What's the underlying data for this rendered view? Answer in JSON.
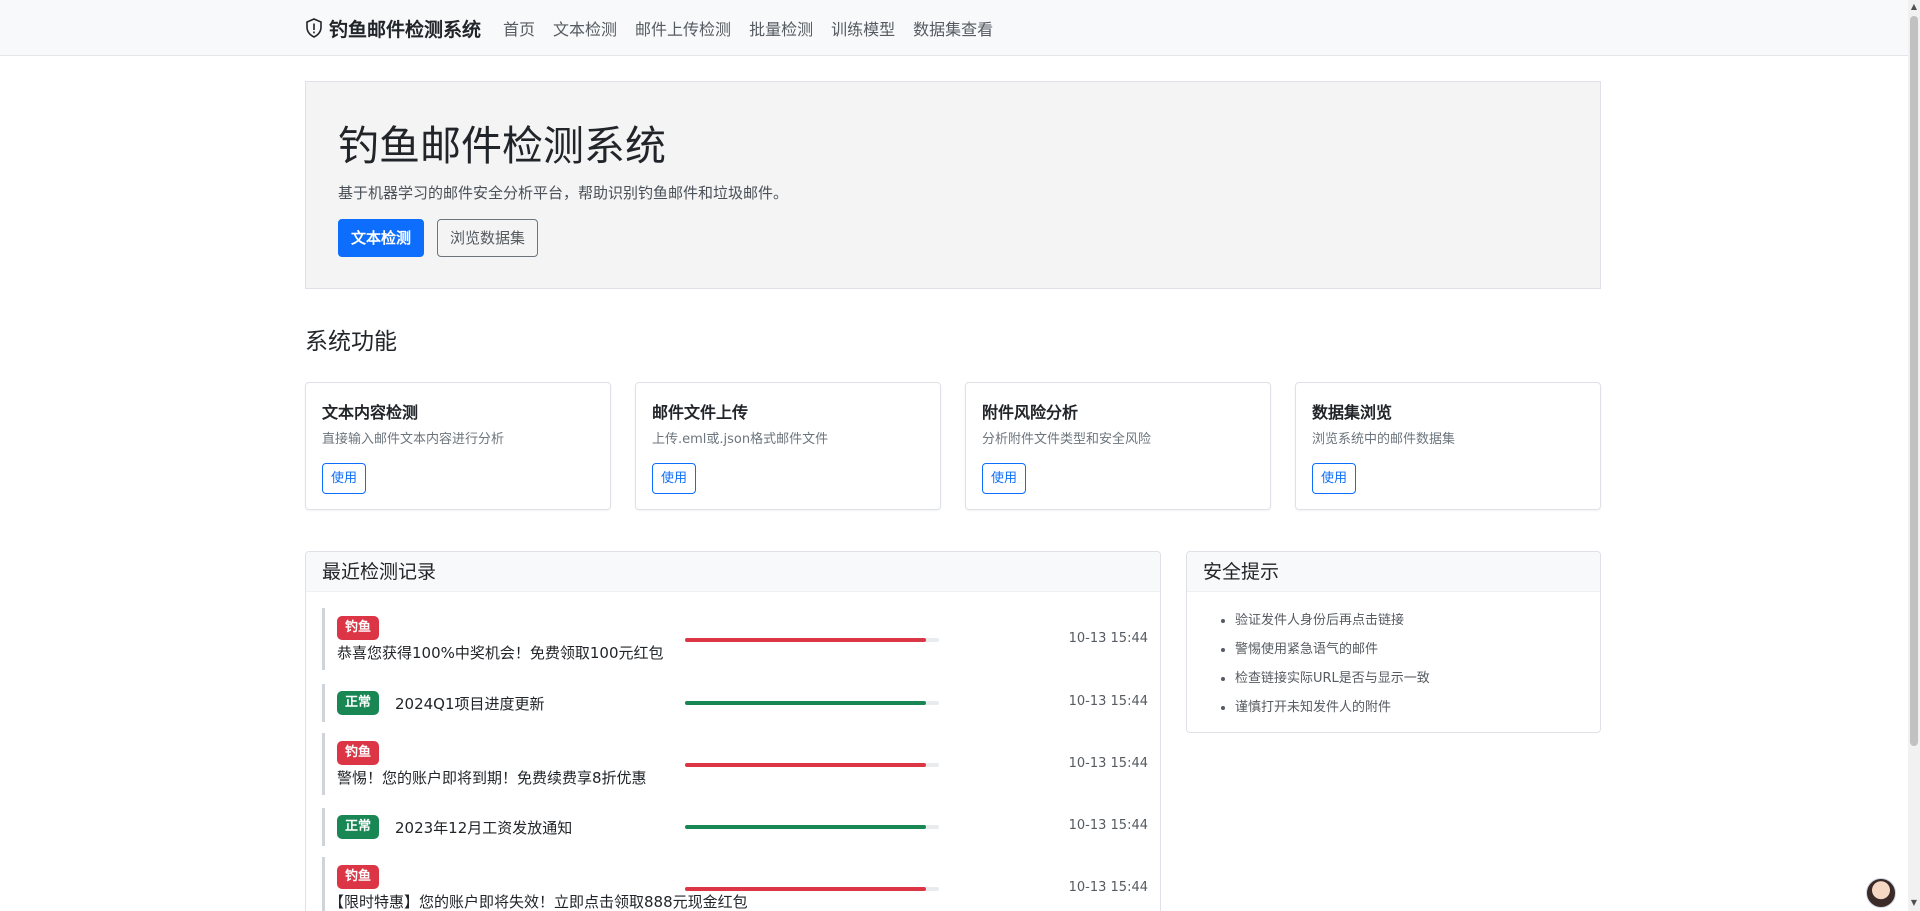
{
  "navbar": {
    "brand": "钓鱼邮件检测系统",
    "links": [
      "首页",
      "文本检测",
      "邮件上传检测",
      "批量检测",
      "训练模型",
      "数据集查看"
    ]
  },
  "hero": {
    "title": "钓鱼邮件检测系统",
    "subtitle": "基于机器学习的邮件安全分析平台，帮助识别钓鱼邮件和垃圾邮件。",
    "primary_button": "文本检测",
    "secondary_button": "浏览数据集"
  },
  "features": {
    "title": "系统功能",
    "cards": [
      {
        "title": "文本内容检测",
        "desc": "直接输入邮件文本内容进行分析",
        "button": "使用"
      },
      {
        "title": "邮件文件上传",
        "desc": "上传.eml或.json格式邮件文件",
        "button": "使用"
      },
      {
        "title": "附件风险分析",
        "desc": "分析附件文件类型和安全风险",
        "button": "使用"
      },
      {
        "title": "数据集浏览",
        "desc": "浏览系统中的邮件数据集",
        "button": "使用"
      }
    ]
  },
  "records": {
    "title": "最近检测记录",
    "items": [
      {
        "label": "钓鱼",
        "status": "phishing",
        "text": "恭喜您获得100%中奖机会！免费领取100元红包",
        "confidence": 0.95,
        "time": "10-13 15:44"
      },
      {
        "label": "正常",
        "status": "normal",
        "text": "2024Q1项目进度更新",
        "confidence": 0.95,
        "time": "10-13 15:44"
      },
      {
        "label": "钓鱼",
        "status": "phishing",
        "text": "警惕！您的账户即将到期！免费续费享8折优惠",
        "confidence": 0.95,
        "time": "10-13 15:44"
      },
      {
        "label": "正常",
        "status": "normal",
        "text": "2023年12月工资发放通知",
        "confidence": 0.95,
        "time": "10-13 15:44"
      },
      {
        "label": "钓鱼",
        "status": "phishing",
        "text": "【限时特惠】您的账户即将失效！立即点击领取888元现金红包",
        "confidence": 0.95,
        "time": "10-13 15:44"
      }
    ]
  },
  "tips": {
    "title": "安全提示",
    "items": [
      "验证发件人身份后再点击链接",
      "警惕使用紧急语气的邮件",
      "检查链接实际URL是否与显示一致",
      "谨慎打开未知发件人的附件"
    ]
  },
  "colors": {
    "primary": "#0d6efd",
    "phishing": "#dc3545",
    "normal": "#198754"
  },
  "icons": {
    "brand": "shield-exclamation-icon",
    "scroll_up": "scroll-up-arrow-icon",
    "scroll_down": "scroll-down-arrow-icon"
  }
}
